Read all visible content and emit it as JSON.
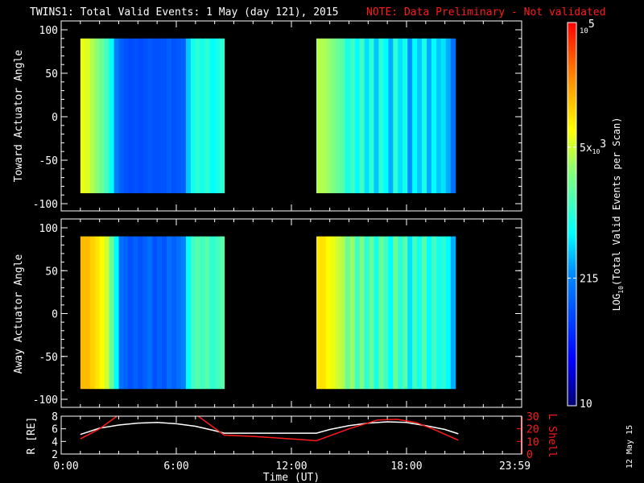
{
  "title": "TWINS1: Total Valid Events:  1 May (day 121), 2015",
  "note": "NOTE: Data Preliminary - Not validated",
  "date_stamp": "12 May 15",
  "chart_data": [
    {
      "type": "heatmap",
      "name": "toward",
      "ylabel": "Toward Actuator Angle",
      "ylim": [
        -110,
        110
      ],
      "yticks": [
        "100",
        "50",
        "0",
        "-50",
        "-100"
      ],
      "ytick_values": [
        100,
        50,
        0,
        -50,
        -100
      ],
      "angle_range": [
        -88,
        90
      ],
      "bin_hours": 0.25,
      "segments": [
        {
          "start": 1.0,
          "values": [
            3.8,
            3.75,
            3.6,
            3.45,
            3.3,
            3.1,
            2.8,
            2.3,
            2.1,
            2.0,
            1.95,
            2.0,
            1.95,
            2.0,
            2.05,
            2.0,
            2.0,
            2.0,
            2.1,
            2.0,
            2.05,
            2.1,
            2.6,
            2.9,
            3.0,
            2.9,
            3.0,
            2.8,
            2.9,
            3.0
          ]
        },
        {
          "start": 13.3,
          "values": [
            3.6,
            3.6,
            3.5,
            3.4,
            3.3,
            3.2,
            2.9,
            3.1,
            2.8,
            3.1,
            2.7,
            3.0,
            2.6,
            3.0,
            2.8,
            2.5,
            3.0,
            2.7,
            2.9,
            2.4,
            2.8,
            2.6,
            2.9,
            2.5,
            2.8,
            2.6,
            2.7,
            2.5,
            2.2
          ]
        }
      ]
    },
    {
      "type": "heatmap",
      "name": "away",
      "ylabel": "Away Actuator Angle",
      "ylim": [
        -110,
        110
      ],
      "yticks": [
        "100",
        "50",
        "0",
        "-50",
        "-100"
      ],
      "ytick_values": [
        100,
        50,
        0,
        -50,
        -100
      ],
      "angle_range": [
        -88,
        90
      ],
      "bin_hours": 0.25,
      "segments": [
        {
          "start": 1.0,
          "values": [
            4.2,
            4.2,
            4.1,
            4.0,
            3.9,
            3.7,
            3.3,
            2.8,
            2.2,
            2.1,
            2.0,
            2.1,
            2.0,
            2.1,
            2.2,
            2.0,
            2.1,
            2.0,
            2.2,
            2.1,
            2.2,
            2.3,
            2.8,
            3.1,
            3.2,
            3.1,
            3.2,
            3.0,
            3.1,
            3.2
          ]
        },
        {
          "start": 13.3,
          "values": [
            4.0,
            4.0,
            3.9,
            3.8,
            3.7,
            3.6,
            3.3,
            3.5,
            3.1,
            3.4,
            3.0,
            3.3,
            2.9,
            3.3,
            3.1,
            2.8,
            3.3,
            3.0,
            3.2,
            2.7,
            3.1,
            2.9,
            3.2,
            2.8,
            3.1,
            2.9,
            3.0,
            2.8,
            2.5
          ]
        }
      ]
    },
    {
      "type": "line",
      "name": "orbit",
      "xlabel": "Time (UT)",
      "xlim": [
        0,
        24
      ],
      "xticks": [
        "0:00",
        "6:00",
        "12:00",
        "18:00",
        "23:59"
      ],
      "xtick_values": [
        0,
        6,
        12,
        18,
        23.98
      ],
      "ylabel_left": "R [RE]",
      "ylim_left": [
        2,
        8
      ],
      "yticks_left": [
        "8",
        "6",
        "4",
        "2"
      ],
      "ylabel_right": "L Shell",
      "ylim_right": [
        0,
        30
      ],
      "yticks_right": [
        "30",
        "20",
        "10",
        "0"
      ],
      "series": [
        {
          "name": "R",
          "color": "#ffffff",
          "axis": "left",
          "x": [
            1.0,
            2,
            3,
            4,
            5,
            6,
            7,
            8,
            8.5,
            13.3,
            14,
            15,
            16,
            17,
            18,
            19,
            20,
            20.7
          ],
          "y": [
            5.1,
            6.1,
            6.6,
            6.9,
            7.0,
            6.8,
            6.4,
            5.7,
            5.3,
            5.3,
            5.9,
            6.5,
            6.9,
            7.1,
            7.0,
            6.5,
            5.9,
            5.2
          ]
        },
        {
          "name": "L Shell",
          "color": "#ff1a1a",
          "axis": "right",
          "x": [
            1.0,
            2.0,
            3.0,
            3.05,
            7.0,
            7.05,
            8.5,
            10,
            11,
            12,
            13.3,
            15,
            16.5,
            17.5,
            18.5,
            19.5,
            20.7
          ],
          "y": [
            12,
            20,
            31,
            null,
            null,
            31,
            15,
            14,
            13,
            12,
            10.5,
            20,
            27,
            27.5,
            25,
            19,
            11
          ]
        }
      ]
    },
    {
      "type": "colorbar",
      "label_main": "LOG",
      "label_sub": "10",
      "label_rest": "(Total Valid Events per Scan)",
      "range_log": [
        1,
        5
      ],
      "ticks": [
        {
          "value": 5,
          "base": "10",
          "exp": "5"
        },
        {
          "value": 3.699,
          "base": "5x",
          "base2": "10",
          "exp": "3"
        },
        {
          "value": 2.332,
          "base": "215"
        },
        {
          "value": 1,
          "base": "10"
        }
      ]
    }
  ]
}
